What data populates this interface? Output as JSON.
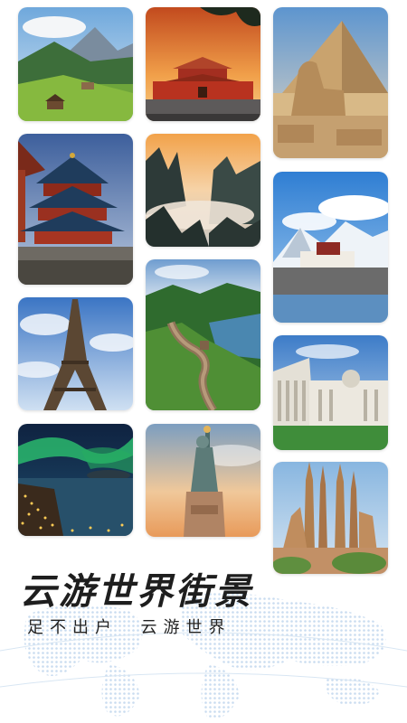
{
  "title": "云游世界街景",
  "subtitle": "足不出户  云游世界",
  "photos": [
    {
      "name": "photo-alpine-meadow",
      "icon": "mountain-meadow"
    },
    {
      "name": "photo-tiananmen",
      "icon": "chinese-palace"
    },
    {
      "name": "photo-pyramid-sphinx",
      "icon": "pyramid"
    },
    {
      "name": "photo-temple-of-heaven",
      "icon": "temple-pagoda"
    },
    {
      "name": "photo-huangshan-peaks",
      "icon": "misty-peaks"
    },
    {
      "name": "photo-potala-palace",
      "icon": "palace-snow-mountain"
    },
    {
      "name": "photo-great-wall",
      "icon": "great-wall"
    },
    {
      "name": "photo-eiffel-tower",
      "icon": "eiffel-tower"
    },
    {
      "name": "photo-pisa-cathedral",
      "icon": "cathedral"
    },
    {
      "name": "photo-aurora-night-town",
      "icon": "aurora"
    },
    {
      "name": "photo-statue-of-liberty",
      "icon": "statue"
    },
    {
      "name": "photo-sagrada-familia",
      "icon": "basilica"
    }
  ]
}
